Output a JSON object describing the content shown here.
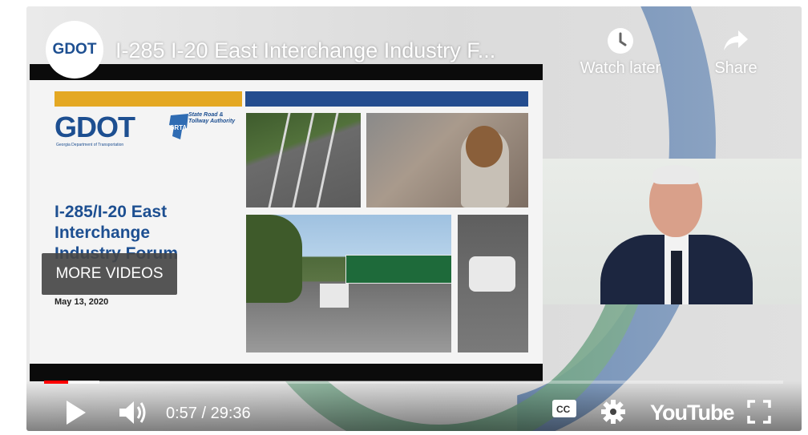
{
  "video": {
    "title": "I-285 I-20 East Interchange Industry F...",
    "channel_logo_text": "GDOT"
  },
  "top_actions": {
    "watch_later_label": "Watch later",
    "share_label": "Share"
  },
  "slide": {
    "logo_text": "GDOT",
    "logo_subtext": "Georgia Department of Transportation",
    "partner_logo_text": "State Road & Tollway Authority",
    "partner_badge": "SRTA",
    "title_lines": [
      "I-285/I-20 East",
      "Interchange",
      "Industry Forum"
    ],
    "date": "May 13, 2020"
  },
  "more_videos_label": "MORE VIDEOS",
  "player": {
    "current_time": "0:57",
    "duration": "29:36",
    "time_display": "0:57 / 29:36",
    "progress_played": 0.032,
    "progress_buffered": 0.075,
    "brand": "YouTube",
    "cc_label": "CC"
  },
  "icons": {
    "play": "play-icon",
    "volume": "volume-icon",
    "cc": "cc-icon",
    "settings": "gear-icon",
    "fullscreen": "fullscreen-icon",
    "watch_later": "clock-icon",
    "share": "share-arrow-icon"
  },
  "colors": {
    "brand_blue": "#1d4f91",
    "accent_gold": "#e4a823",
    "progress_red": "#ff0000"
  }
}
